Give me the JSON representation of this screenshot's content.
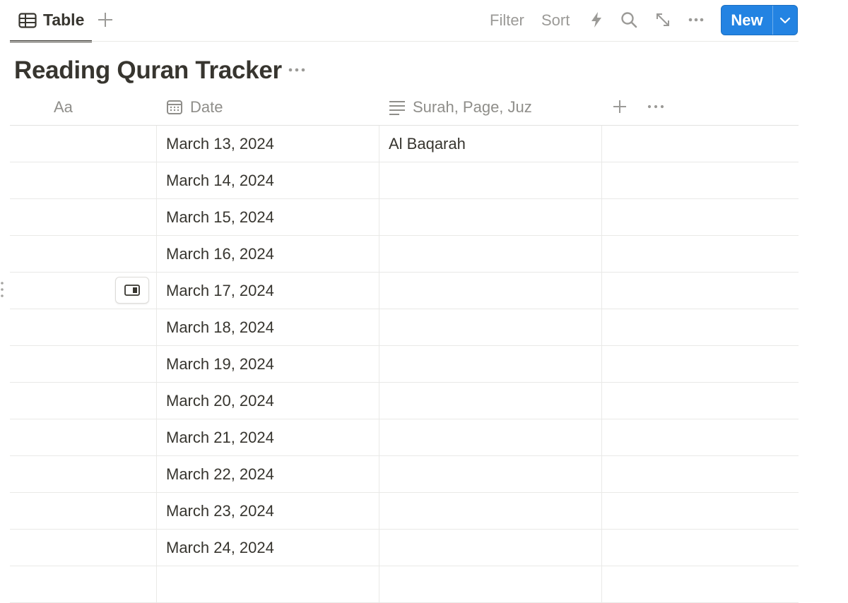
{
  "toolbar": {
    "view_tab_label": "Table",
    "filter_label": "Filter",
    "sort_label": "Sort",
    "new_label": "New"
  },
  "page": {
    "title": "Reading Quran Tracker"
  },
  "columns": {
    "name": "Aa",
    "date": "Date",
    "surah": "Surah, Page, Juz"
  },
  "rows": [
    {
      "date": "March 13, 2024",
      "surah": "Al Baqarah"
    },
    {
      "date": "March 14, 2024",
      "surah": ""
    },
    {
      "date": "March 15, 2024",
      "surah": ""
    },
    {
      "date": "March 16, 2024",
      "surah": ""
    },
    {
      "date": "March 17, 2024",
      "surah": ""
    },
    {
      "date": "March 18, 2024",
      "surah": ""
    },
    {
      "date": "March 19, 2024",
      "surah": ""
    },
    {
      "date": "March 20, 2024",
      "surah": ""
    },
    {
      "date": "March 21, 2024",
      "surah": ""
    },
    {
      "date": "March 22, 2024",
      "surah": ""
    },
    {
      "date": "March 23, 2024",
      "surah": ""
    },
    {
      "date": "March 24, 2024",
      "surah": ""
    },
    {
      "date": "",
      "surah": ""
    }
  ],
  "hover_row_index": 4,
  "colors": {
    "accent": "#2383e2",
    "text": "#37352f",
    "muted": "#9b9a97",
    "border": "#e9e9e7"
  },
  "icons": {
    "view_tab": "table-icon",
    "add_view": "plus-icon",
    "automation": "lightning-icon",
    "search": "search-icon",
    "expand": "expand-icon",
    "more": "more-horizontal-icon",
    "new_dropdown": "chevron-down-icon",
    "date_property": "calendar-icon",
    "text_property": "text-lines-icon",
    "add_property": "plus-icon",
    "open_row": "open-side-peek-icon",
    "drag": "drag-handle-icon"
  }
}
